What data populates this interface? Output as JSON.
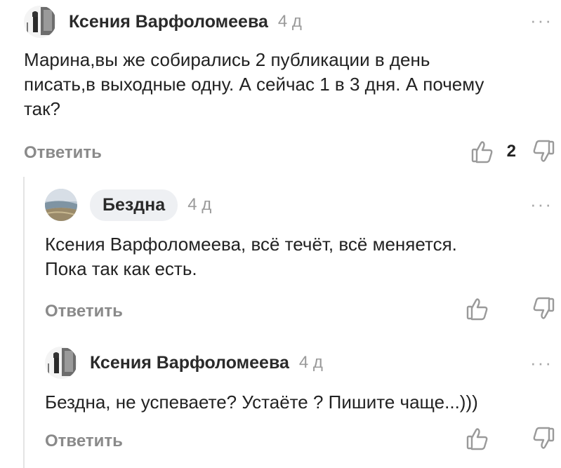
{
  "comments": [
    {
      "author": "Ксения Варфоломеева",
      "time": "4 д",
      "text": "Марина,вы же собирались 2 публикации в день\nписать,в выходные одну. А сейчас 1 в 3 дня. А почему\nтак?",
      "reply": "Ответить",
      "likes": "2",
      "more": "···"
    },
    {
      "author": "Бездна",
      "time": "4 д",
      "text": "Ксения Варфоломеева, всё течёт, всё меняется.\nПока так как есть.",
      "reply": "Ответить",
      "likes": "",
      "more": "···"
    },
    {
      "author": "Ксения Варфоломеева",
      "time": "4 д",
      "text": "Бездна, не успеваете? Устаёте ? Пишите чаще...)))",
      "reply": "Ответить",
      "likes": "",
      "more": "···"
    }
  ],
  "icons": {
    "like": "thumbs-up-icon",
    "dislike": "thumbs-down-icon",
    "more": "more-dots-icon"
  },
  "colors": {
    "muted": "#8a8a8a",
    "time": "#9a9a9a",
    "pill": "#eef0f3"
  }
}
